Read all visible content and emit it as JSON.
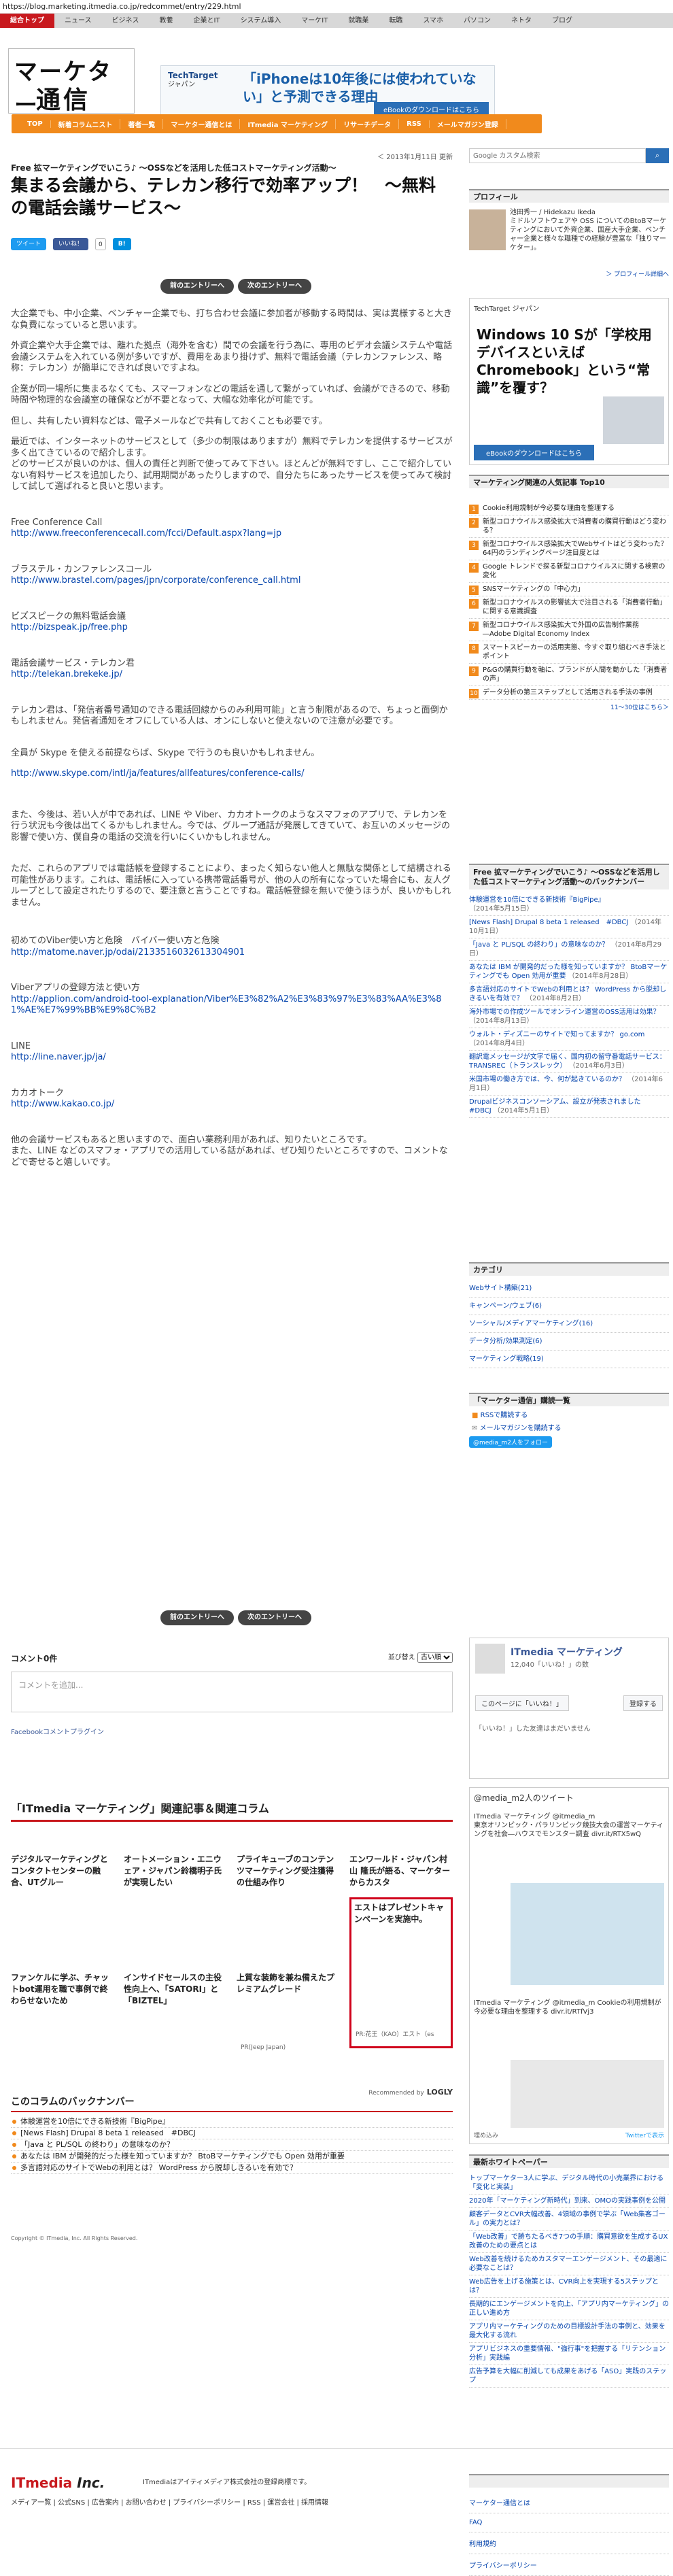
{
  "url": "https://blog.marketing.itmedia.co.jp/redcommet/entry/229.html",
  "topnav": [
    "総合トップ",
    "ニュース",
    "ビジネス",
    "教養",
    "企業とIT",
    "システム導入",
    "マーケIT",
    "就職業",
    "転職",
    "スマホ",
    "パソコン",
    "ネトタ",
    "ブログ"
  ],
  "logo": {
    "line1": "マーケター",
    "line2": "通信"
  },
  "banner": {
    "brand": "TechTarget",
    "brand_sub": "ジャパン",
    "headline": "「iPhoneは10年後には使われていない」と予測できる理由",
    "cta": "eBookのダウンロードはこちら"
  },
  "orangenav": [
    "TOP",
    "新着コラムニスト",
    "著者一覧",
    "マーケター通信とは",
    "ITmedia マーケティング",
    "リサーチデータ",
    "RSS",
    "メールマガジン登録"
  ],
  "article": {
    "date": "＜ 2013年1月11日 更新",
    "category": "Free 拡マーケティングでいこう♪ 〜OSSなどを活用した低コストマーケティング活動〜",
    "title": "集まる会議から、テレカン移行で効率アップ！　〜無料の電話会議サービス〜",
    "tweet": "ツイート",
    "like": "いいね！",
    "like_count": "0",
    "hatena": "B!",
    "prev": "前のエントリーへ",
    "next": "次のエントリーへ",
    "paragraphs": [
      "大企業でも、中小企業、ベンチャー企業でも、打ち合わせ会議に参加者が移動する時間は、実は異様すると大きな負費になっていると思います。",
      "外資企業や大手企業では、離れた拠点（海外を含む）間での会議を行う為に、専用のビデオ会議システムや電話会議システムを入れている例が多いですが、費用をあまり掛けず、無料で電話会議（テレカンファレンス、略称：テレカン）が簡単にできれば良いですよね。",
      "企業が同一場所に集まるなくても、スマーフォンなどの電話を通して繋がっていれば、会議ができるので、移動時間や物理的な会議室の確保などが不要となって、大幅な効率化が可能です。",
      "但し、共有したい資料などは、電子メールなどで共有しておくことも必要です。",
      "最近では、インターネットのサービスとして（多少の制限はありますが）無料でテレカンを提供するサービスが多く出てきているので紹介します。\nどのサービスが良いのかは、個人の責任と判断で使ってみて下さい。ほとんどが無料ですし、ここで紹介していない有料サービスを追加したり、試用期間があったりしますので、自分たちにあったサービスを使ってみて検討して試して選ばれると良いと思います。"
    ],
    "services": [
      {
        "name": "Free Conference Call",
        "url": "http://www.freeconferencecall.com/fcci/Default.aspx?lang=jp"
      },
      {
        "name": "ブラステル・カンファレンスコール",
        "url": "http://www.brastel.com/pages/jpn/corporate/conference_call.html"
      },
      {
        "name": "ビズスピークの無料電話会議",
        "url": "http://bizspeak.jp/free.php"
      },
      {
        "name": "電話会議サービス・テレカン君",
        "url": "http://telekan.brekeke.jp/"
      }
    ],
    "paragraphs2": [
      "テレカン君は、「発信者番号通知のできる電話回線からのみ利用可能」と言う制限があるので、ちょっと面倒かもしれません。発信者通知をオフにしている人は、オンにしないと使えないので注意が必要です。",
      "全員が Skype を使える前提ならば、Skype で行うのも良いかもしれません。"
    ],
    "skype_url": "http://www.skype.com/intl/ja/features/allfeatures/conference-calls/",
    "paragraphs3": [
      "また、今後は、若い人が中であれば、LINE や Viber、カカオトークのようなスマフォのアプリで、テレカンを行う状況も今後は出てくるかもしれません。今では、グループ通話が発展してきていて、お互いのメッセージの影響で使い方、僕自身の電話の交流を行いにくいかもしれません。",
      "ただ、これらのアプリでは電話帳を登録することにより、まったく知らない他人と無駄な関係として結構される可能性があります。これは、電話帳に入っている携帯電話番号が、他の人の所有になっていた場合にも、友人グループとして設定されたりするので、要注意と言うことですね。電話帳登録を無いで使うほうが、良いかもしれません。"
    ],
    "line_viber": [
      {
        "name": "初めてのViber使い方と危険　バイバー使い方と危険",
        "url": "http://matome.naver.jp/odai/2133516032613304901"
      },
      {
        "name": "Viberアプリの登録方法と使い方",
        "url": "http://applion.com/android-tool-explanation/Viber%E3%82%A2%E3%83%97%E3%83%AA%E3%81%AE%E7%99%BB%E9%8C%B2"
      },
      {
        "name": "LINE",
        "url": "http://line.naver.jp/ja/"
      },
      {
        "name": "カカオトーク",
        "url": "http://www.kakao.co.jp/"
      }
    ],
    "closing": "他の会議サービスもあると思いますので、面白い業務利用があれば、知りたいところです。\nまた、LINE などのスマフォ・アプリでの活用している話があれば、ぜひ知りたいところですので、コメントなどで寄せると嬉しいです。"
  },
  "comments": {
    "header": "コメント0件",
    "sort_label": "並び替え",
    "sort_value": "古い順",
    "placeholder": "コメントを追加...",
    "plugin": "Facebookコメントプラグイン"
  },
  "related": {
    "heading": "「ITmedia マーケティング」関連記事＆関連コラム",
    "row1": [
      "デジタルマーケティングとコンタクトセンターの融合、UTグルー",
      "オートメーション・エニウェア・ジャパン鈴橋明子氏が実現したい",
      "プライキューブのコンテンツマーケティング受注獲得の仕組み作り",
      "エンワールド・ジャパン村山 隆氏が語る、マーケターからカスタ"
    ],
    "row2": [
      "ファンケルに学ぶ、チャットbot運用を職で事例で終わらせないため",
      "インサイドセールスの主役性向上へ、「SATORI」と「BIZTEL」",
      "上質な装飾を兼ね備えたプレミアムグレード",
      "エストはプレゼントキャンペーンを実施中。"
    ],
    "pr1": "PR(Jeep Japan)",
    "pr2": "PR:花王（KAO）エスト（es",
    "recommended": "Recommended by",
    "recommended_brand": "LOGLY"
  },
  "backnumber": {
    "heading": "このコラムのバックナンバー",
    "items": [
      "体験運営を10倍にできる新技術『BigPipe』",
      "[News Flash] Drupal 8 beta 1 released　#DBCJ",
      "「Java と PL/SQL の終わり」の意味なのか？",
      "あなたは IBM が開発的だった様を知っていますか？ BtoBマーケティングでも Open 効用が重要",
      "多言語対応のサイトでWebの利用とは？ WordPress から脱却しきるいを有効で？"
    ]
  },
  "copyright": "Copyright © ITmedia, Inc. All Rights Reserved.",
  "sidebar": {
    "search_placeholder": "Google カスタム検索",
    "profile_head": "プロフィール",
    "profile_text": "池田秀一 / Hidekazu Ikeda\nミドルソフトウェアや OSS についてのBtoBマーケティングにおいて外資企業、国産大手企業、ベンチャー企業と様々な職種での経験が豊富な「独りマーケター」。",
    "profile_more": "＞ プロフィール詳細へ",
    "ad_brand": "TechTarget ジャパン",
    "ad_headline": "Windows 10 Sが「学校用デバイスといえばChromebook」という“常識”を覆す？",
    "ad_cta": "eBookのダウンロードはこちら",
    "ranking_head": "マーケティング関連の人気記事 Top10",
    "ranking": [
      "Cookie利用規制が今必要な理由を整理する",
      "新型コロナウイルス感染拡大で消費者の購買行動はどう変わる？",
      "新型コロナウイルス感染拡大でWebサイトはどう変わった？ 64円のランディングページ注目度とは",
      "Google トレンドで探る新型コロナウイルスに関する検索の変化",
      "SNSマーケティングの「中心力」",
      "新型コロナウイルスの影響拡大で注目される「消費者行動」に関する意識調査",
      "新型コロナウイルス感染拡大で外国の広告制作業務 ―Adobe Digital Economy Index",
      "スマートスピーカーの活用実態、今すぐ取り組むべき手法とポイント",
      "P&Gの購買行動を軸に、ブランドが人間を動かした「消費者の声」",
      "データ分析の第三ステップとして活用される手法の事例"
    ],
    "ranking_more": "11〜30位はこちら＞",
    "popular_head": "Free 拡マーケティングでいこう♪ 〜OSSなどを活用した低コストマーケティング活動〜のバックナンバー",
    "popular": [
      {
        "t": "体験運営を10倍にできる新技術『BigPipe』",
        "d": "（2014年5月15日）"
      },
      {
        "t": "[News Flash] Drupal 8 beta 1 released　#DBCJ",
        "d": "（2014年10月1日）"
      },
      {
        "t": "「Java と PL/SQL の終わり」の意味なのか？",
        "d": "（2014年8月29日）"
      },
      {
        "t": "あなたは IBM が開発的だった様を知っていますか？ BtoBマーケティングでも Open 効用が重要",
        "d": "（2014年8月28日）"
      },
      {
        "t": "多言語対応のサイトでWebの利用とは？ WordPress から脱却しきるいを有効で？",
        "d": "（2014年8月2日）"
      },
      {
        "t": "海外市場での作成ツールでオンライン運営のOSS活用は効果？",
        "d": "（2014年8月13日）"
      },
      {
        "t": "ウォルト・ディズニーのサイトで知ってますか？ go.com",
        "d": "（2014年8月4日）"
      },
      {
        "t": "翻訳電メッセージが文字で届く、国内初の留守番電話サービス：TRANSREC（トランスレック）",
        "d": "（2014年6月3日）"
      },
      {
        "t": "米国市場の働き方では、今、何が起きているのか？",
        "d": "（2014年6月1日）"
      },
      {
        "t": "Drupalビジネスコンソーシアム、設立が発表されました　#DBCJ",
        "d": "（2014年5月1日）"
      }
    ],
    "category_head": "カテゴリ",
    "categories": [
      "Webサイト構築(21)",
      "キャンペーン/ウェブ(6)",
      "ソーシャル/メディアマーケティング(16)",
      "データ分析/効果測定(6)",
      "マーケティング戦略(19)"
    ],
    "subscribe_head": "「マーケター通信」購読一覧",
    "subscribe": [
      "RSSで購読する",
      "メールマガジンを購読する"
    ],
    "twitter_follow": "@media_m2人をフォロー",
    "fb_name": "ITmedia マーケティング",
    "fb_likes": "12,040「いいね！」の数",
    "fb_like_btn": "このページに「いいね！」",
    "fb_share_btn": "登録する",
    "fb_friends": "「いいね！」した友達はまだいません",
    "tw_head": "@media_m2人のツイート",
    "tw_text": "ITmedia マーケティング @itmedia_m\n東京オリンピック・パラリンピック競技大会の運営マーケティングを社会―ハウスでモンスター調査 divr.it/RTX5wQ",
    "tw_text2": "ITmedia マーケティング @itmedia_m\nCookieの利用規制が今必要な理由を整理する divr.it/RTfVj3",
    "tw_embed": "埋め込み",
    "tw_view": "Twitterで表示",
    "new_head": "最新ホワイトペーパー",
    "new": [
      "トップマーケター3人に学ぶ、デジタル時代の小売業界における「変化と実装」",
      "2020年「マーケティング新時代」到来、OMOの実践事例を公開",
      "顧客データとCVR大幅改善、4領域の事例で学ぶ「Web集客ゴール」の実力とは？",
      "「Web改善」で勝ちたるべき7つの手順：購買意欲を生成するUX改善のための要点とは",
      "Web改善を続けるためカスタマーエンゲージメント、その最適に必要なことは？",
      "Web広告を上げる施策とは、CVR向上を実現する5ステップとは？",
      "長期的にエンゲージメントを向上、「アプリ内マーケティング」の正しい進め方",
      "アプリ内マーケティングのための目標設計手法の事例と、効果を最大化する流れ",
      "アプリビジネスの重要情報、\"強行事\"を把握する「リテンション分析」実践編",
      "広告予算を大幅に削減しても成果をあげる「ASO」実践のステップ"
    ],
    "links_head": "",
    "links": [
      "マーケター通信とは",
      "FAQ",
      "利用規約",
      "プライバシーポリシー"
    ]
  },
  "footer": {
    "logo": "ITmedia",
    "logo_suffix": "Inc.",
    "text": "ITmediaはアイティメディア株式会社の登録商標です。",
    "links": "メディア一覧 | 公式SNS | 広告案内 | お問い合わせ | プライバシーポリシー | RSS | 運営会社 | 採用情報"
  },
  "colors": {
    "brand_red": "#c8191e",
    "nav_orange": "#f18a1c",
    "link": "#0645ad"
  }
}
